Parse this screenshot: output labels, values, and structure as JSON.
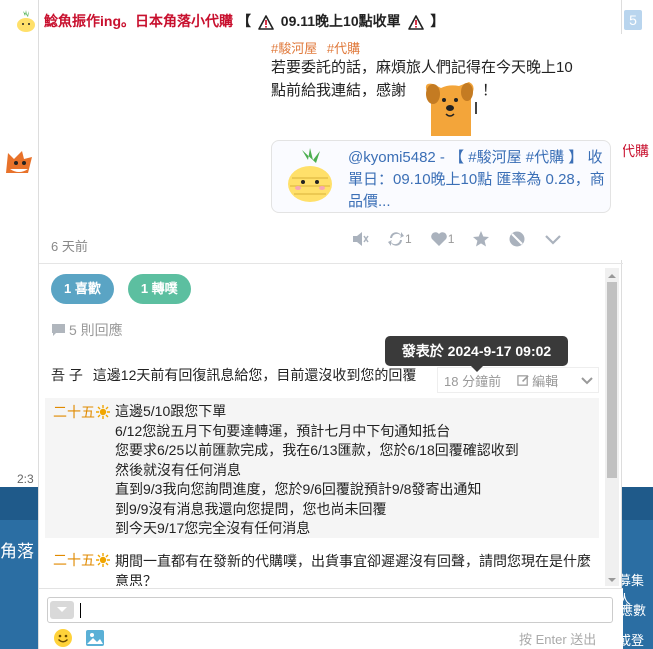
{
  "background": {
    "right_red_text": "代購",
    "right_num": "5",
    "left_time": "2:3",
    "left_bottom_text": "角落",
    "right_bottom_1": "募集人",
    "right_bottom_2": "應數",
    "right_bottom_3": "或登入"
  },
  "header": {
    "title_red": "鯰魚振作ing。日本角落小代購",
    "title_open": "【",
    "title_middle": "09.11晚上10點收單",
    "title_close": "】"
  },
  "post": {
    "hashtags": [
      "#駿河屋",
      "#代購"
    ],
    "line1": "若要委託的話，麻煩旅人們記得在今天晚上10",
    "line2_a": "點前給我連結，感謝",
    "line2_b": "！",
    "quote": {
      "text": "@kyomi5482 - 【 #駿河屋 #代購 】 收單日：09.10晚上10點 匯率為 0.28，商品價..."
    },
    "time": "6 天前",
    "actions": {
      "repost_count": "1",
      "like_count": "1"
    }
  },
  "stats": {
    "likes": "1 喜歡",
    "reposts": "1 轉噗",
    "replies": "5 則回應"
  },
  "tooltip": "發表於 2024-9-17 09:02",
  "comments": [
    {
      "author": "吾 子",
      "text": "這邊12天前有回復訊息給您，目前還沒收到您的回覆",
      "meta_time": "18 分鐘前",
      "meta_edit": "編輯"
    },
    {
      "author": "二十五",
      "lines": [
        "這邊5/10跟您下單",
        "6/12您說五月下旬要達轉運，預計七月中下旬通知抵台",
        "您要求6/25以前匯款完成，我在6/13匯款，您於6/18回覆確認收到",
        "然後就沒有任何消息",
        "直到9/3我向您詢問進度，您於9/6回覆說預計9/8發寄出通知",
        "到9/9沒有消息我還向您提問，您也尚未回覆",
        "到今天9/17您完全沒有任何消息"
      ]
    },
    {
      "author": "二十五",
      "text": "期間一直都有在發新的代購噗，出貨事宜卻遲遲沒有回聲，請問您現在是什麼意思？"
    }
  ],
  "composer": {
    "hint": "按 Enter 送出"
  }
}
